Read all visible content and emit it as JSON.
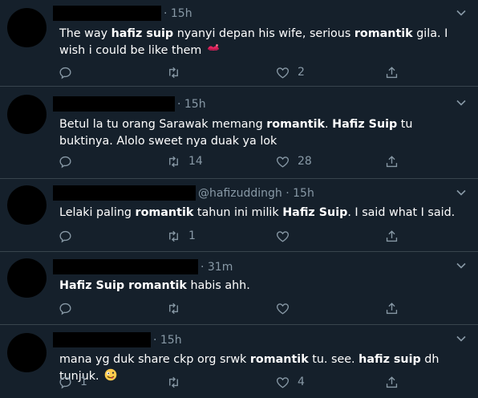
{
  "tweets": [
    {
      "handle": "",
      "time": "· 15h",
      "segments": [
        {
          "t": "The way ",
          "b": false
        },
        {
          "t": "hafiz suip",
          "b": true
        },
        {
          "t": " nyanyi depan his wife, serious ",
          "b": false
        },
        {
          "t": "romantik",
          "b": true
        },
        {
          "t": " gila. I wish i could be like them ",
          "b": false
        }
      ],
      "emoji": "kiss-mark-emoji",
      "replies": "",
      "retweets": "",
      "likes": "2"
    },
    {
      "handle": "",
      "time": "· 15h",
      "segments": [
        {
          "t": "Betul la tu orang Sarawak memang ",
          "b": false
        },
        {
          "t": "romantik",
          "b": true
        },
        {
          "t": ". ",
          "b": false
        },
        {
          "t": "Hafiz Suip",
          "b": true
        },
        {
          "t": " tu buktinya. Alolo sweet nya duak ya lok",
          "b": false
        }
      ],
      "replies": "",
      "retweets": "14",
      "likes": "28"
    },
    {
      "handle": "@hafizuddingh",
      "time": "· 15h",
      "segments": [
        {
          "t": "Lelaki paling ",
          "b": false
        },
        {
          "t": "romantik",
          "b": true
        },
        {
          "t": " tahun ini milik ",
          "b": false
        },
        {
          "t": "Hafiz Suip",
          "b": true
        },
        {
          "t": ". I said what I said.",
          "b": false
        }
      ],
      "replies": "",
      "retweets": "1",
      "likes": ""
    },
    {
      "handle": "",
      "time": "· 31m",
      "segments": [
        {
          "t": "Hafiz Suip romantik",
          "b": true
        },
        {
          "t": " habis ahh.",
          "b": false
        }
      ],
      "replies": "",
      "retweets": "",
      "likes": ""
    },
    {
      "handle": "",
      "time": "· 15h",
      "segments": [
        {
          "t": "mana yg duk share ckp org srwk ",
          "b": false
        },
        {
          "t": "romantik",
          "b": true
        },
        {
          "t": " tu. see. ",
          "b": false
        },
        {
          "t": "hafiz suip",
          "b": true
        },
        {
          "t": " dh tunjuk. ",
          "b": false
        }
      ],
      "emoji": "zany-face-emoji",
      "replies": "1",
      "retweets": "",
      "likes": "4"
    }
  ],
  "colors": {
    "background": "#15202b",
    "divider": "#38444d",
    "muted": "#8899a6",
    "text": "#ffffff"
  }
}
